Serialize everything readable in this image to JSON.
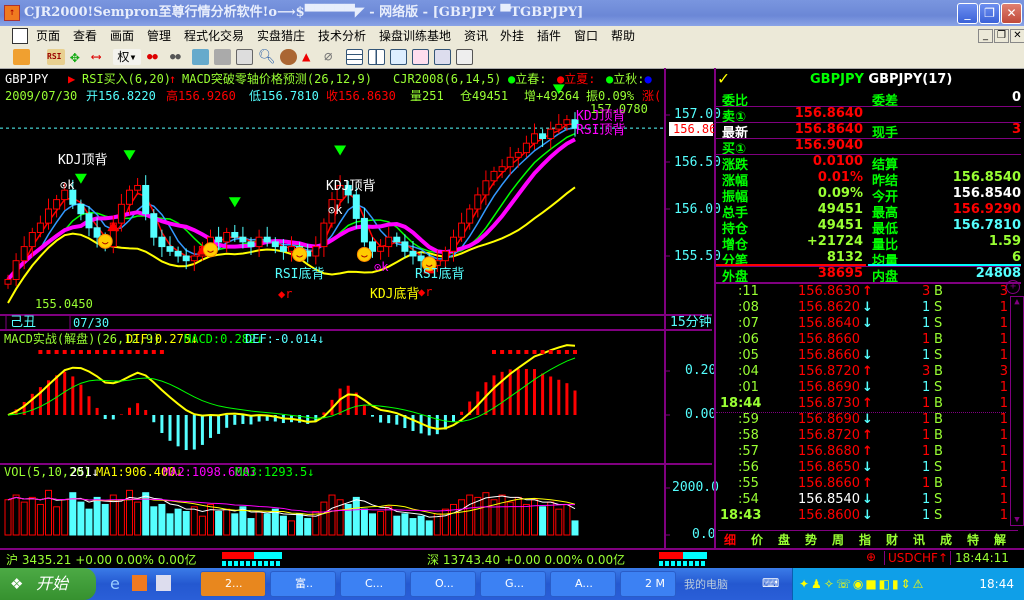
{
  "window": {
    "title": "CJR2000!Sempron至尊行情分析软件!o⟶$▀▀▀▀▀◤ - 网络版 - [GBPJPY ▀TGBPJPY]",
    "minimize": "_",
    "restore": "❐",
    "close": "✕"
  },
  "menu": [
    "页面",
    "查看",
    "画面",
    "管理",
    "程式化交易",
    "实盘猎庄",
    "技术分析",
    "操盘训练基地",
    "资讯",
    "外挂",
    "插件",
    "窗口",
    "帮助"
  ],
  "toolbar": {
    "rsi": "RSI",
    "quan": "权"
  },
  "chart": {
    "header1": {
      "symbol": "GBPJPY",
      "rsi": "RSI买入(6,20)",
      "macd": "MACD突破零轴价格预测(26,12,9)",
      "cjr": "CJR2008(6,14,5)",
      "l1": "立春:",
      "l2": "立夏:",
      "l3": "立秋:"
    },
    "header2": {
      "date": "2009/07/30",
      "open": "开156.8220",
      "high": "高156.9260",
      "low": "低156.7810",
      "close": "收156.8630",
      "vol": "量251",
      "oi": "仓49451",
      "inc": "增+49264",
      "amp": "振0.09%",
      "chg": "涨("
    },
    "high_label": "157.0780",
    "low_label": "155.0450",
    "current_price": "156.86",
    "annotations": {
      "kdj_top1": "KDJ顶背",
      "kdj_top2": "KDJ顶背",
      "ok1": "⊙k",
      "ok2": "⊙k",
      "ok3": "⊙k",
      "rsi_bottom1": "RSI底背",
      "rsi_bottom2": "RSI底背",
      "kdj_bottom": "KDJ底背",
      "r1": "r",
      "r2": "r",
      "r3": "r",
      "rsi_top": "RSI顶背",
      "kdj_top3": "KDJ顶背"
    },
    "price_axis": [
      "157.00",
      "156.50",
      "156.00",
      "155.50"
    ],
    "date_bar": {
      "ganzhi": "己丑",
      "date": "07/30",
      "period": "15分钟"
    },
    "macd_header": {
      "title": "MACD实战(解盘)(26,12,9)",
      "dif": "DIF:0.275↓",
      "macd": "MACD:0.282↓",
      "def": "DEF:-0.014↓"
    },
    "macd_axis": [
      "0.20",
      "0.00"
    ],
    "vol_header": {
      "title": "VOL(5,10,20)",
      "vol": "251↓",
      "ma1": "MA1:906.400↓",
      "ma2": "MA2:1098.600↓",
      "ma3": "MA3:1293.5↓"
    },
    "vol_axis": [
      "2000.0",
      "0.0"
    ]
  },
  "chart_data": {
    "type": "candlestick",
    "symbol": "GBPJPY",
    "period": "15min",
    "ylim": [
      155.0,
      157.1
    ],
    "closes": [
      155.25,
      155.45,
      155.6,
      155.75,
      155.85,
      156.0,
      156.1,
      156.2,
      156.05,
      155.95,
      155.8,
      155.7,
      155.6,
      155.85,
      156.05,
      156.2,
      156.25,
      155.95,
      155.7,
      155.6,
      155.55,
      155.5,
      155.45,
      155.5,
      155.6,
      155.7,
      155.65,
      155.75,
      155.7,
      155.65,
      155.6,
      155.7,
      155.65,
      155.6,
      155.55,
      155.6,
      155.55,
      155.5,
      155.6,
      155.85,
      156.1,
      156.25,
      156.15,
      155.9,
      155.65,
      155.55,
      155.6,
      155.7,
      155.65,
      155.55,
      155.5,
      155.45,
      155.4,
      155.45,
      155.55,
      155.7,
      155.85,
      156.0,
      156.15,
      156.3,
      156.4,
      156.45,
      156.55,
      156.6,
      156.7,
      156.8,
      156.75,
      156.85,
      156.9,
      156.95,
      156.86
    ],
    "volume": [
      1500,
      1700,
      1400,
      1600,
      1300,
      1900,
      1200,
      1500,
      1800,
      1400,
      1100,
      1600,
      1300,
      1700,
      1500,
      1900,
      1400,
      1800,
      1200,
      1300,
      900,
      1100,
      1000,
      1200,
      800,
      1300,
      1000,
      1100,
      900,
      1200,
      700,
      1000,
      900,
      1100,
      800,
      600,
      900,
      700,
      1000,
      1400,
      1700,
      1500,
      1300,
      1600,
      1100,
      900,
      1000,
      1200,
      800,
      900,
      700,
      800,
      600,
      900,
      1100,
      1300,
      1500,
      1700,
      1600,
      1800,
      1500,
      1700,
      1400,
      1600,
      1300,
      1500,
      1200,
      1400,
      1100,
      1300,
      600
    ]
  },
  "quote": {
    "title_code": "GBPJPY",
    "title_name": "GBPJPY(17)",
    "rows": [
      {
        "l": "委比",
        "v": "",
        "l2": "委差",
        "v2": "0"
      },
      {
        "l": "卖①",
        "v": "156.8640",
        "l2": "",
        "v2": ""
      },
      {
        "l": "最新",
        "v": "156.8640",
        "l2": "现手",
        "v2": "3"
      },
      {
        "l": "买①",
        "v": "156.9040",
        "l2": "",
        "v2": ""
      },
      {
        "l": "涨跌",
        "v": "0.0100",
        "l2": "结算",
        "v2": ""
      },
      {
        "l": "涨幅",
        "v": "0.01%",
        "l2": "昨结",
        "v2": "156.8540"
      },
      {
        "l": "振幅",
        "v": "0.09%",
        "l2": "今开",
        "v2": "156.8540"
      },
      {
        "l": "总手",
        "v": "49451",
        "l2": "最高",
        "v2": "156.9290"
      },
      {
        "l": "持仓",
        "v": "49451",
        "l2": "最低",
        "v2": "156.7810"
      },
      {
        "l": "增仓",
        "v": "+21724",
        "l2": "量比",
        "v2": "1.59"
      },
      {
        "l": "分笔",
        "v": "8132",
        "l2": "均量",
        "v2": "6"
      },
      {
        "l": "外盘",
        "v": "38695",
        "l2": "内盘",
        "v2": "24808"
      }
    ],
    "ticks": [
      {
        "t": ":11",
        "p": "156.8630",
        "a": "↑",
        "n": "3",
        "s": "B",
        "c": "3"
      },
      {
        "t": ":08",
        "p": "156.8620",
        "a": "↓",
        "n": "1",
        "s": "S",
        "c": "1"
      },
      {
        "t": ":07",
        "p": "156.8640",
        "a": "↓",
        "n": "1",
        "s": "S",
        "c": "1"
      },
      {
        "t": ":06",
        "p": "156.8660",
        "a": "",
        "n": "1",
        "s": "B",
        "c": "1"
      },
      {
        "t": ":05",
        "p": "156.8660",
        "a": "↓",
        "n": "1",
        "s": "S",
        "c": "1"
      },
      {
        "t": ":04",
        "p": "156.8720",
        "a": "↑",
        "n": "3",
        "s": "B",
        "c": "3"
      },
      {
        "t": ":01",
        "p": "156.8690",
        "a": "↓",
        "n": "1",
        "s": "S",
        "c": "1"
      },
      {
        "t": "18:44",
        "p": "156.8730",
        "a": "↑",
        "n": "1",
        "s": "B",
        "c": "1"
      },
      {
        "t": ":59",
        "p": "156.8690",
        "a": "↓",
        "n": "1",
        "s": "B",
        "c": "1"
      },
      {
        "t": ":58",
        "p": "156.8720",
        "a": "↑",
        "n": "1",
        "s": "B",
        "c": "1"
      },
      {
        "t": ":57",
        "p": "156.8680",
        "a": "↑",
        "n": "1",
        "s": "B",
        "c": "1"
      },
      {
        "t": ":56",
        "p": "156.8650",
        "a": "↓",
        "n": "1",
        "s": "S",
        "c": "1"
      },
      {
        "t": ":55",
        "p": "156.8660",
        "a": "↑",
        "n": "1",
        "s": "B",
        "c": "1"
      },
      {
        "t": ":54",
        "p": "156.8540",
        "a": "↓",
        "n": "1",
        "s": "S",
        "c": "1"
      },
      {
        "t": "18:43",
        "p": "156.8600",
        "a": "↓",
        "n": "1",
        "s": "S",
        "c": "1"
      }
    ],
    "tabs": [
      "细",
      "价",
      "盘",
      "势",
      "周",
      "指",
      "财",
      "讯",
      "成",
      "特",
      "解"
    ]
  },
  "status": {
    "sh": "沪 3435.21 +0.00 0.00% 0.00亿",
    "sz": "深 13743.40 +0.00 0.00% 0.00亿",
    "fx": "USDCHF↑",
    "time": "18:44:11"
  },
  "taskbar": {
    "start": "开始",
    "tasks": [
      "2...",
      "富..",
      "C...",
      "O...",
      "G...",
      "A...",
      "2 M"
    ],
    "mycomputer": "我的电脑",
    "clock": "18:44"
  },
  "colors": {
    "up": "#ff0000",
    "down": "#54ffff",
    "axis": "#800080"
  }
}
